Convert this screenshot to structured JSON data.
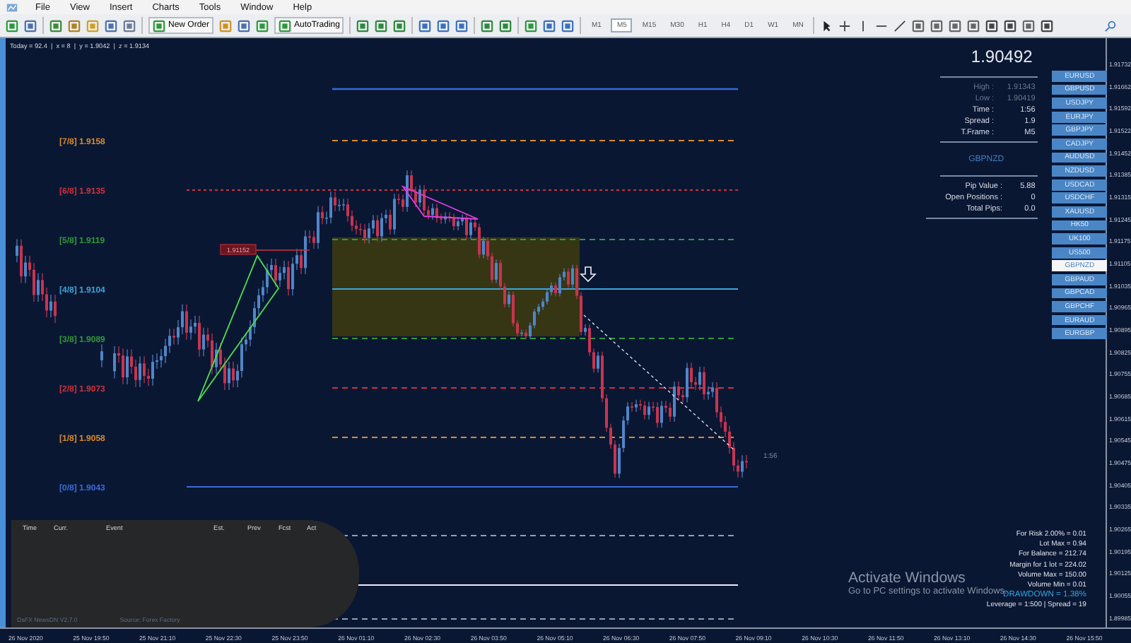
{
  "menu": [
    "File",
    "View",
    "Insert",
    "Charts",
    "Tools",
    "Window",
    "Help"
  ],
  "toolbar": {
    "new_order": "New Order",
    "auto_trading": "AutoTrading",
    "timeframes": [
      {
        "label": "M1",
        "selected": false
      },
      {
        "label": "M5",
        "selected": true
      },
      {
        "label": "M15",
        "selected": false
      },
      {
        "label": "M30",
        "selected": false
      },
      {
        "label": "H1",
        "selected": false
      },
      {
        "label": "H4",
        "selected": false
      },
      {
        "label": "D1",
        "selected": false
      },
      {
        "label": "W1",
        "selected": false
      },
      {
        "label": "MN",
        "selected": false
      }
    ]
  },
  "chart": {
    "info_line": "Today = 92.4  |  x = 8  |  y = 1.9042  |  z = 1.9134",
    "levels": [
      {
        "label": "[7/8]",
        "value": "1.9158",
        "color": "#d98c2b"
      },
      {
        "label": "[6/8]",
        "value": "1.9135",
        "color": "#d0303c"
      },
      {
        "label": "[5/8]",
        "value": "1.9119",
        "color": "#2e9a3a"
      },
      {
        "label": "[4/8]",
        "value": "1.9104",
        "color": "#3aa6d8"
      },
      {
        "label": "[3/8]",
        "value": "1.9089",
        "color": "#2e9a3a"
      },
      {
        "label": "[2/8]",
        "value": "1.9073",
        "color": "#d0303c"
      },
      {
        "label": "[1/8]",
        "value": "1.9058",
        "color": "#d98c2b"
      },
      {
        "label": "[0/8]",
        "value": "1.9043",
        "color": "#3a6ad8"
      }
    ],
    "marker_price": "1.91152",
    "timer": "1:56",
    "y_axis": [
      "1.91732",
      "1.91662",
      "1.91592",
      "1.91522",
      "1.91452",
      "1.91385",
      "1.91315",
      "1.91245",
      "1.91175",
      "1.91105",
      "1.91035",
      "1.90965",
      "1.90895",
      "1.90825",
      "1.90755",
      "1.90685",
      "1.90615",
      "1.90545",
      "1.90475",
      "1.90405",
      "1.90335",
      "1.90265",
      "1.90195",
      "1.90125",
      "1.90055",
      "1.89985"
    ],
    "x_axis": [
      "26 Nov 2020",
      "25 Nov 19:50",
      "25 Nov 21:10",
      "25 Nov 22:30",
      "25 Nov 23:50",
      "26 Nov 01:10",
      "26 Nov 02:30",
      "26 Nov 03:50",
      "26 Nov 05:10",
      "26 Nov 06:30",
      "26 Nov 07:50",
      "26 Nov 09:10",
      "26 Nov 10:30",
      "26 Nov 11:50",
      "26 Nov 13:10",
      "26 Nov 14:30",
      "26 Nov 15:50"
    ]
  },
  "market_panel": {
    "price": "1.90492",
    "stats": [
      {
        "label": "High :",
        "value": "1.91343",
        "muted": true
      },
      {
        "label": "Low :",
        "value": "1.90419",
        "muted": true
      },
      {
        "label": "Time :",
        "value": "1:56",
        "muted": false
      },
      {
        "label": "Spread :",
        "value": "1.9",
        "muted": false
      },
      {
        "label": "T.Frame :",
        "value": "M5",
        "muted": false
      }
    ],
    "symbol": "GBPNZD",
    "account": [
      {
        "label": "Pip Value :",
        "value": "5.88"
      },
      {
        "label": "Open Positions :",
        "value": "0"
      },
      {
        "label": "Total Pips:",
        "value": "0.0"
      }
    ],
    "symbols": [
      {
        "label": "EURUSD",
        "selected": false
      },
      {
        "label": "GBPUSD",
        "selected": false
      },
      {
        "label": "USDJPY",
        "selected": false
      },
      {
        "label": "EURJPY",
        "selected": false
      },
      {
        "label": "GBPJPY",
        "selected": false
      },
      {
        "label": "CADJPY",
        "selected": false
      },
      {
        "label": "AUDUSD",
        "selected": false
      },
      {
        "label": "NZDUSD",
        "selected": false
      },
      {
        "label": "USDCAD",
        "selected": false
      },
      {
        "label": "USDCHF",
        "selected": false
      },
      {
        "label": "XAUUSD",
        "selected": false
      },
      {
        "label": "HK50",
        "selected": false
      },
      {
        "label": "UK100",
        "selected": false
      },
      {
        "label": "US500",
        "selected": false
      },
      {
        "label": "GBPNZD",
        "selected": true
      },
      {
        "label": "GBPAUD",
        "selected": false
      },
      {
        "label": "GBPCAD",
        "selected": false
      },
      {
        "label": "GBPCHF",
        "selected": false
      },
      {
        "label": "EURAUD",
        "selected": false
      },
      {
        "label": "EURGBP",
        "selected": false
      }
    ]
  },
  "news": {
    "columns": [
      "Time",
      "Curr.",
      "Event",
      "Est.",
      "Prev",
      "Fcst",
      "Act"
    ],
    "footer_left": "DaFX NewsDN V2.7.0",
    "footer_source": "Source: Forex Factory"
  },
  "risk_info": [
    {
      "text": "For Risk 2.00% = 0.01",
      "kind": "normal"
    },
    {
      "text": "Lot Max = 0.94",
      "kind": "normal"
    },
    {
      "text": "For Balance = 212.74",
      "kind": "normal"
    },
    {
      "text": "Margin for 1 lot = 224.02",
      "kind": "normal"
    },
    {
      "text": "Volume Max = 150.00",
      "kind": "normal"
    },
    {
      "text": "Volume Min = 0.01",
      "kind": "normal"
    },
    {
      "text": "DRAWDOWN =  1.38%",
      "kind": "highlight"
    },
    {
      "text": "Leverage = 1:500 | Spread = 19",
      "kind": "normal"
    }
  ],
  "os_notice": {
    "title": "Activate Windows",
    "subtitle": "Go to PC settings to activate Windows."
  }
}
